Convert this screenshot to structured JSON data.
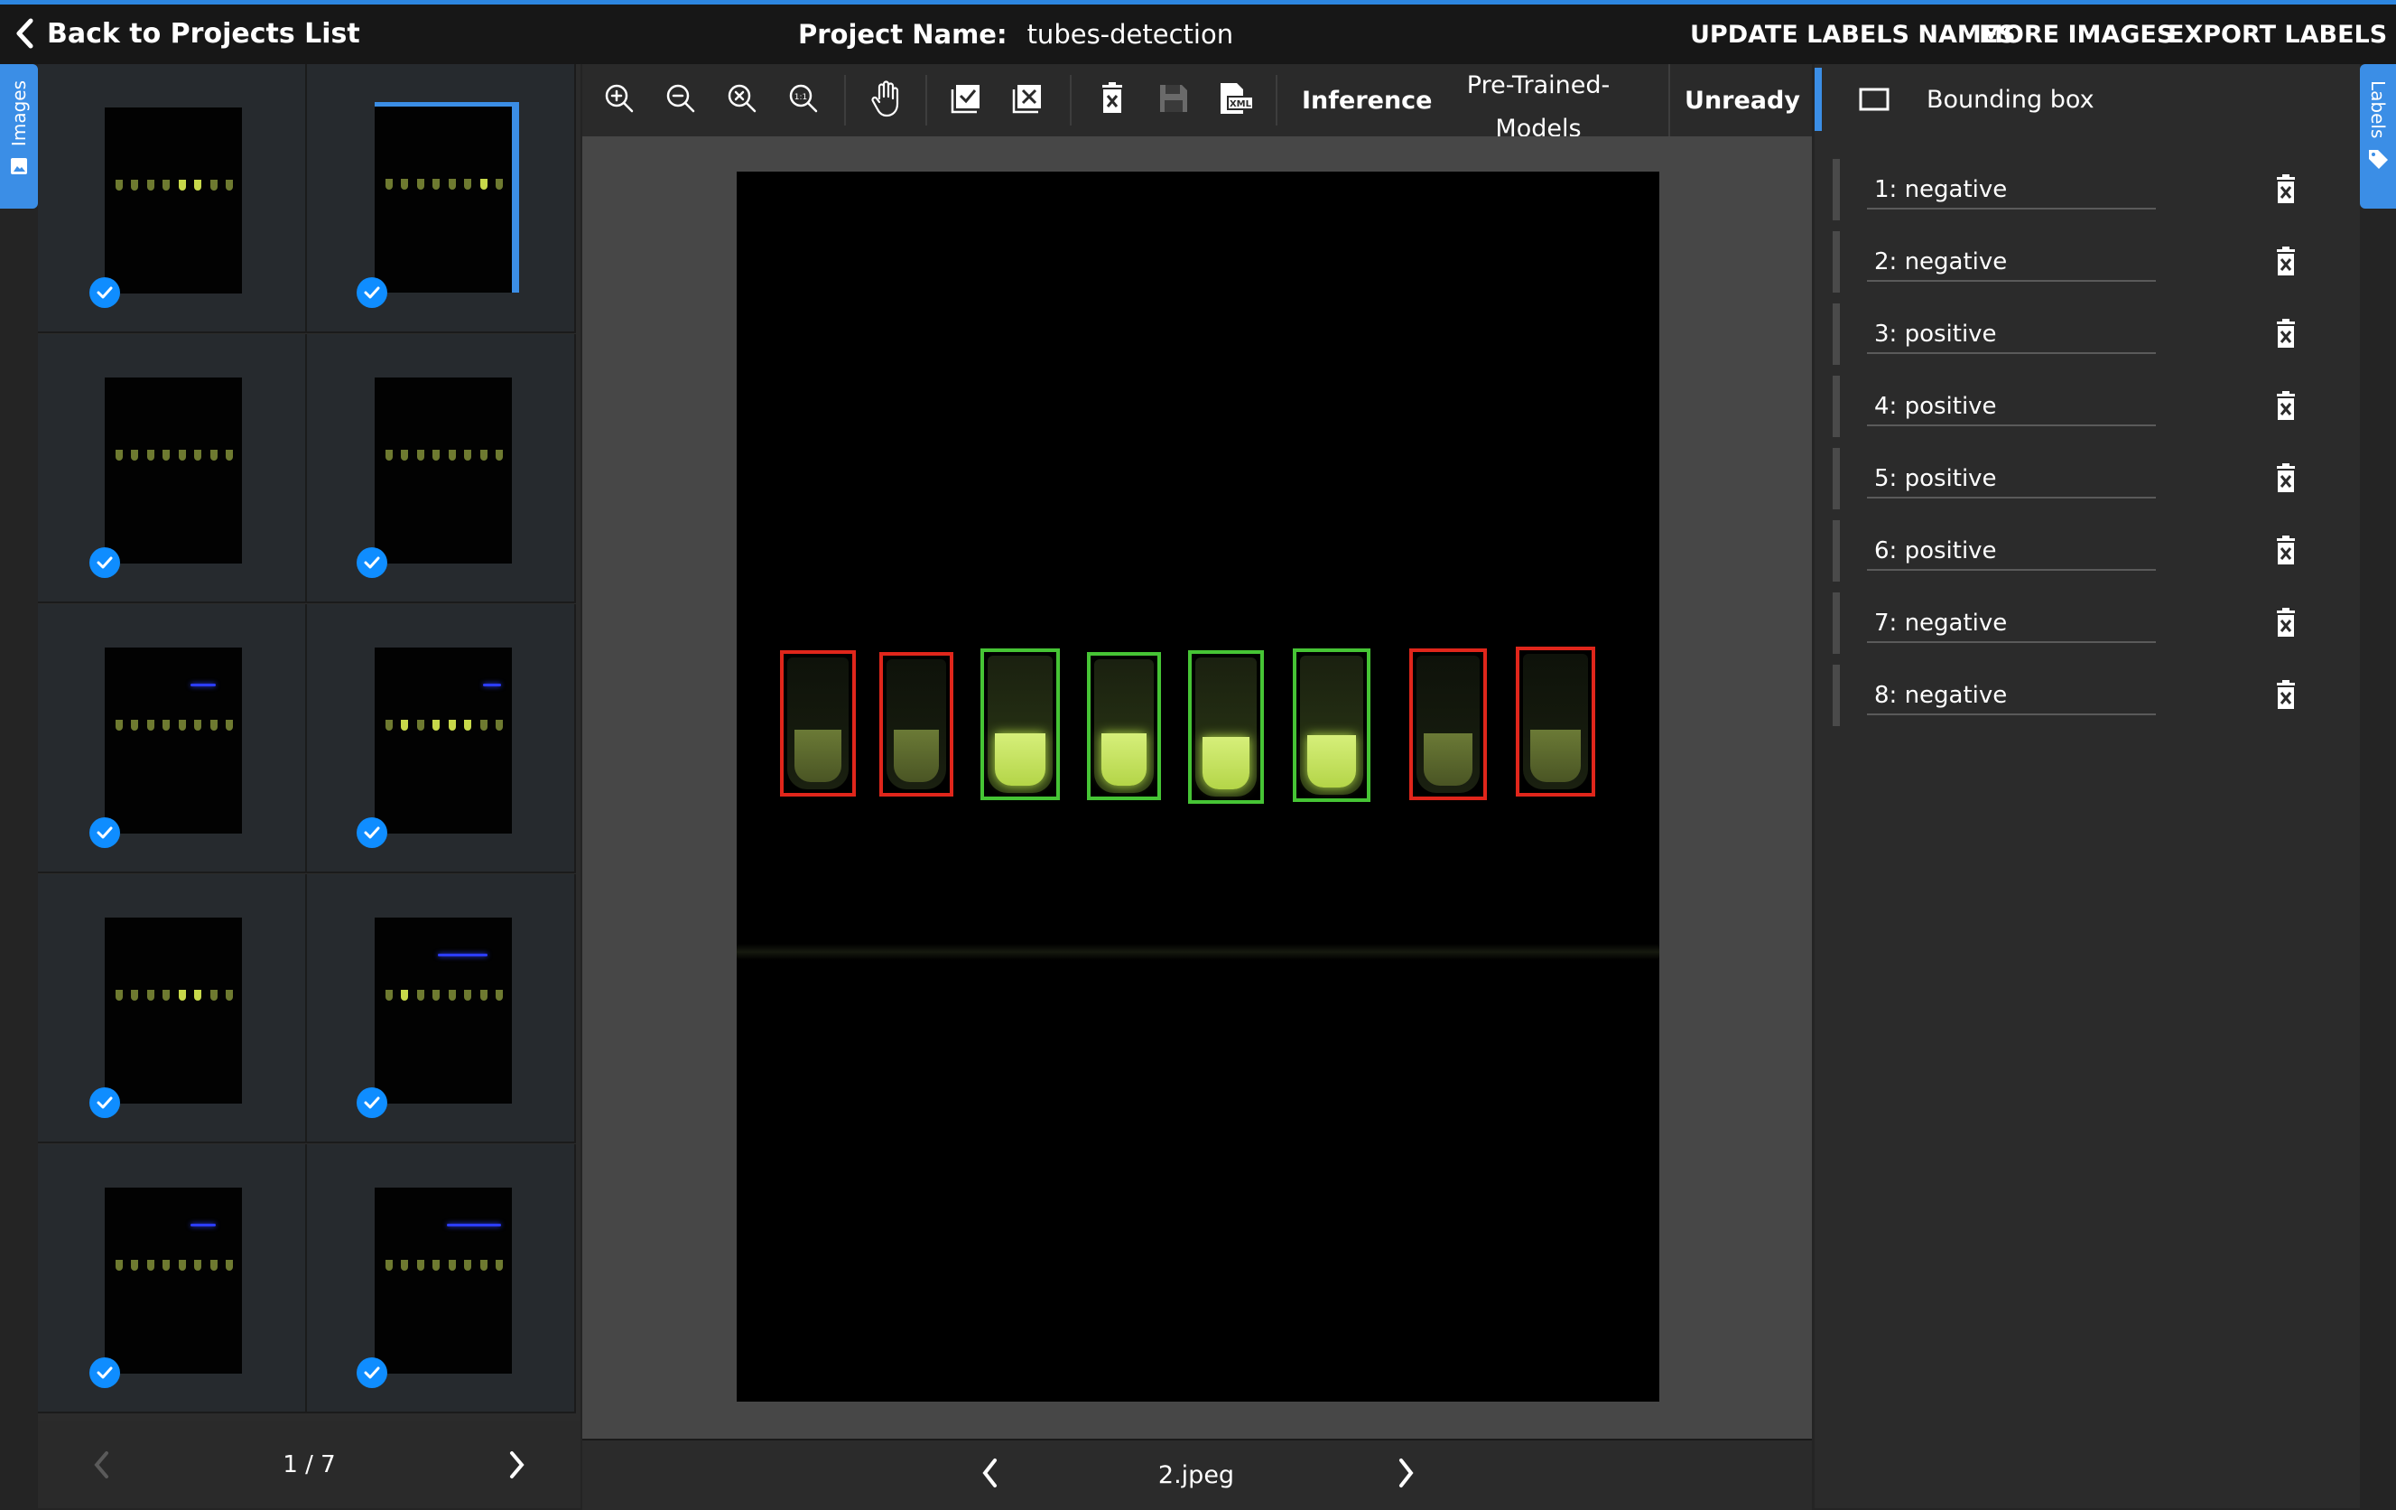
{
  "header": {
    "back_label": "Back to Projects List",
    "project_label": "Project Name:",
    "project_name": "tubes-detection",
    "menu": [
      "UPDATE LABELS NAMES",
      "MORE IMAGES",
      "EXPORT LABELS"
    ]
  },
  "side_tabs": {
    "images": "Images",
    "labels": "Labels"
  },
  "thumbnails": {
    "page": "1 / 7",
    "selected_index": 1,
    "items": [
      {
        "checked": true
      },
      {
        "checked": true
      },
      {
        "checked": true
      },
      {
        "checked": true
      },
      {
        "checked": true
      },
      {
        "checked": true
      },
      {
        "checked": true
      },
      {
        "checked": true
      },
      {
        "checked": true
      },
      {
        "checked": true
      }
    ]
  },
  "toolbar": {
    "tools": [
      "zoom-in",
      "zoom-out",
      "zoom-fit",
      "zoom-1-1",
      "pan",
      "accept-all",
      "reject-all",
      "delete",
      "save",
      "export-xml"
    ],
    "zoom_1_1_text": "1:1",
    "xml_text": "XML",
    "inference": "Inference",
    "pretrained_line1": "Pre-Trained-",
    "pretrained_line2": "Models",
    "status": "Unready"
  },
  "viewer": {
    "image_name": "2.jpeg",
    "detections": [
      {
        "label": "negative",
        "color": "#e0261b"
      },
      {
        "label": "negative",
        "color": "#e0261b"
      },
      {
        "label": "positive",
        "color": "#46c435"
      },
      {
        "label": "positive",
        "color": "#46c435"
      },
      {
        "label": "positive",
        "color": "#46c435"
      },
      {
        "label": "positive",
        "color": "#46c435"
      },
      {
        "label": "negative",
        "color": "#e0261b"
      },
      {
        "label": "negative",
        "color": "#e0261b"
      }
    ]
  },
  "labels_panel": {
    "tool_label": "Bounding box",
    "labels": [
      "1: negative",
      "2: negative",
      "3: positive",
      "4: positive",
      "5: positive",
      "6: positive",
      "7: negative",
      "8: negative"
    ]
  },
  "colors": {
    "accent": "#3b8ee6",
    "check": "#0f8dff",
    "positive": "#46c435",
    "negative": "#e0261b"
  }
}
